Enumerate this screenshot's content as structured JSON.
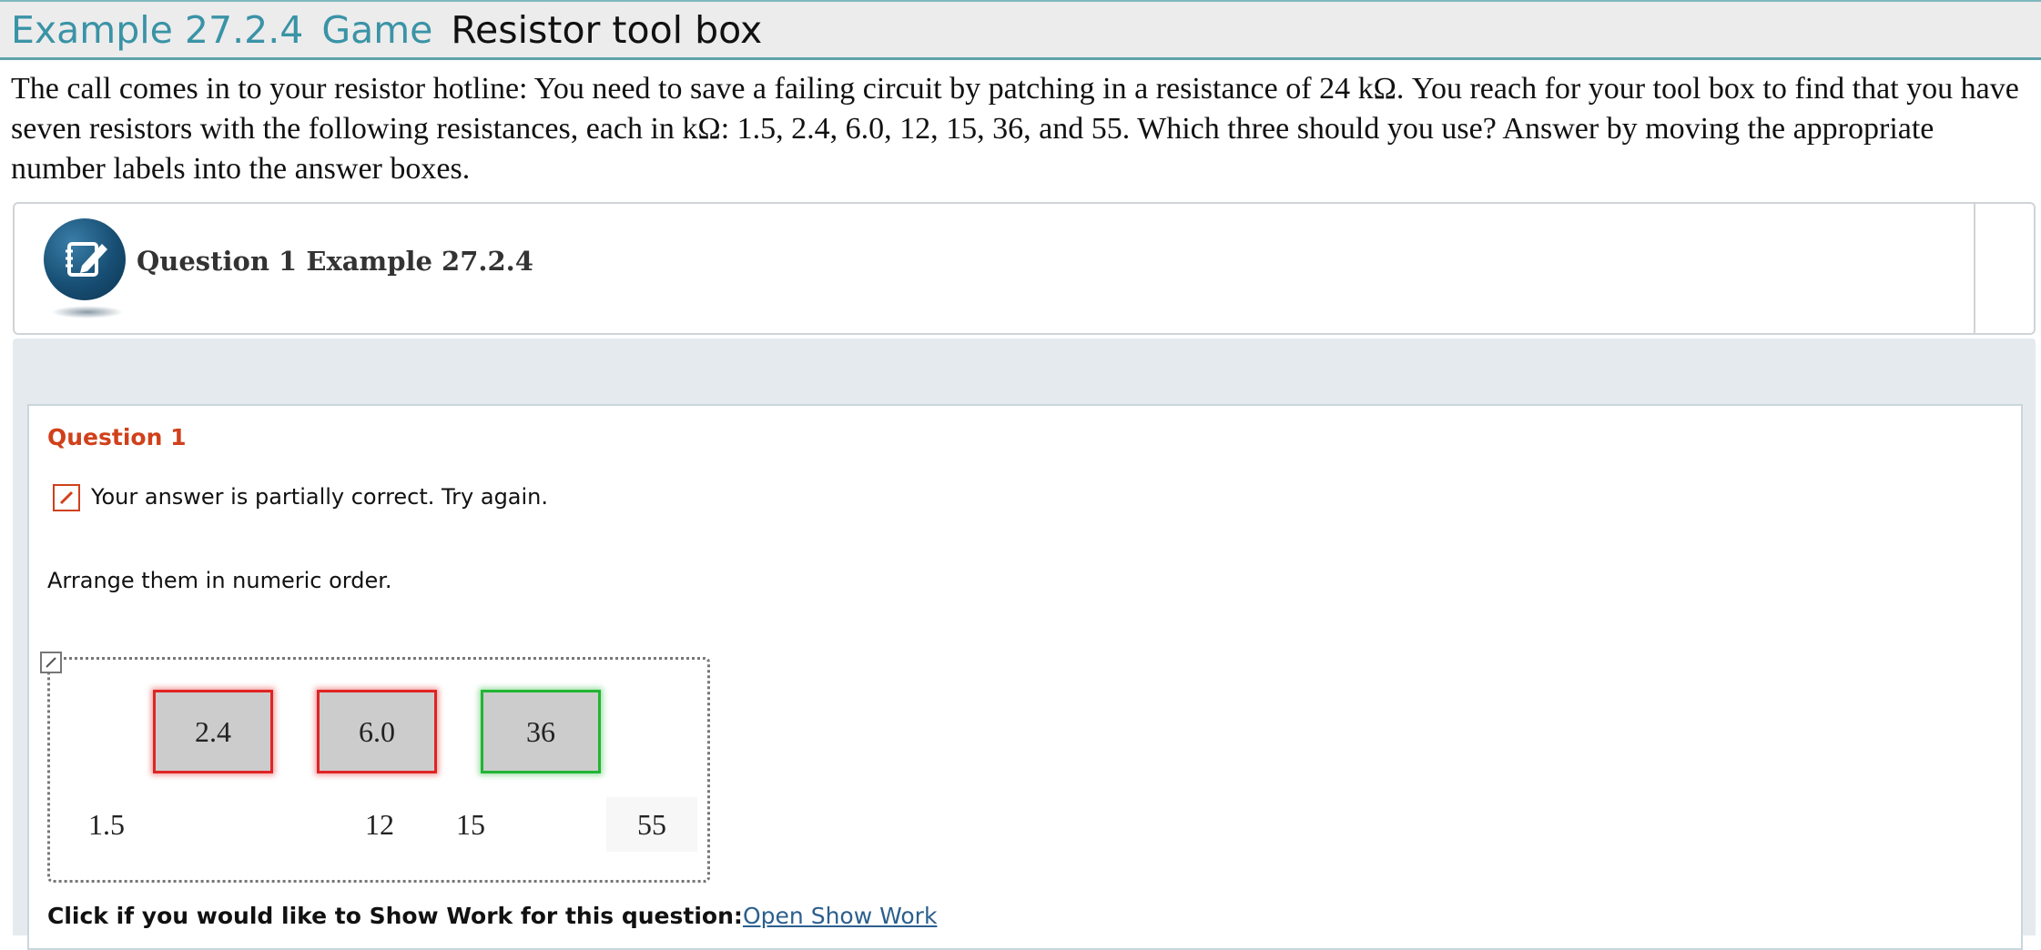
{
  "header": {
    "example_number": "Example 27.2.4",
    "type": "Game",
    "title": "Resistor tool box"
  },
  "problem_text": "The call comes in to your resistor hotline: You need to save a failing circuit by patching in a resistance of 24 kΩ. You reach for your tool box to find that you have seven resistors with the following resistances, each in kΩ: 1.5, 2.4, 6.0, 12, 15, 36, and 55. Which three should you use? Answer by moving the appropriate number labels into the answer boxes.",
  "question_header": {
    "icon": "notepad-pencil-icon",
    "title": "Question 1 Example 27.2.4"
  },
  "question": {
    "label": "Question 1",
    "feedback_icon": "partially-correct-pencil-icon",
    "feedback_text": "Your answer is partially correct.  Try again.",
    "instruction": "Arrange them in numeric order.",
    "answer_boxes": [
      {
        "value": "2.4",
        "status": "incorrect"
      },
      {
        "value": "6.0",
        "status": "incorrect"
      },
      {
        "value": "36",
        "status": "correct"
      }
    ],
    "available_labels": [
      "1.5",
      "12",
      "15",
      "55"
    ],
    "show_work_label": "Click if you would like to Show Work for this question:",
    "show_work_link": "Open Show Work"
  },
  "colors": {
    "title_teal": "#3a93a6",
    "question_orange": "#d0411b",
    "incorrect_red": "#e02424",
    "correct_green": "#21b534",
    "link_blue": "#2b5f8e"
  }
}
